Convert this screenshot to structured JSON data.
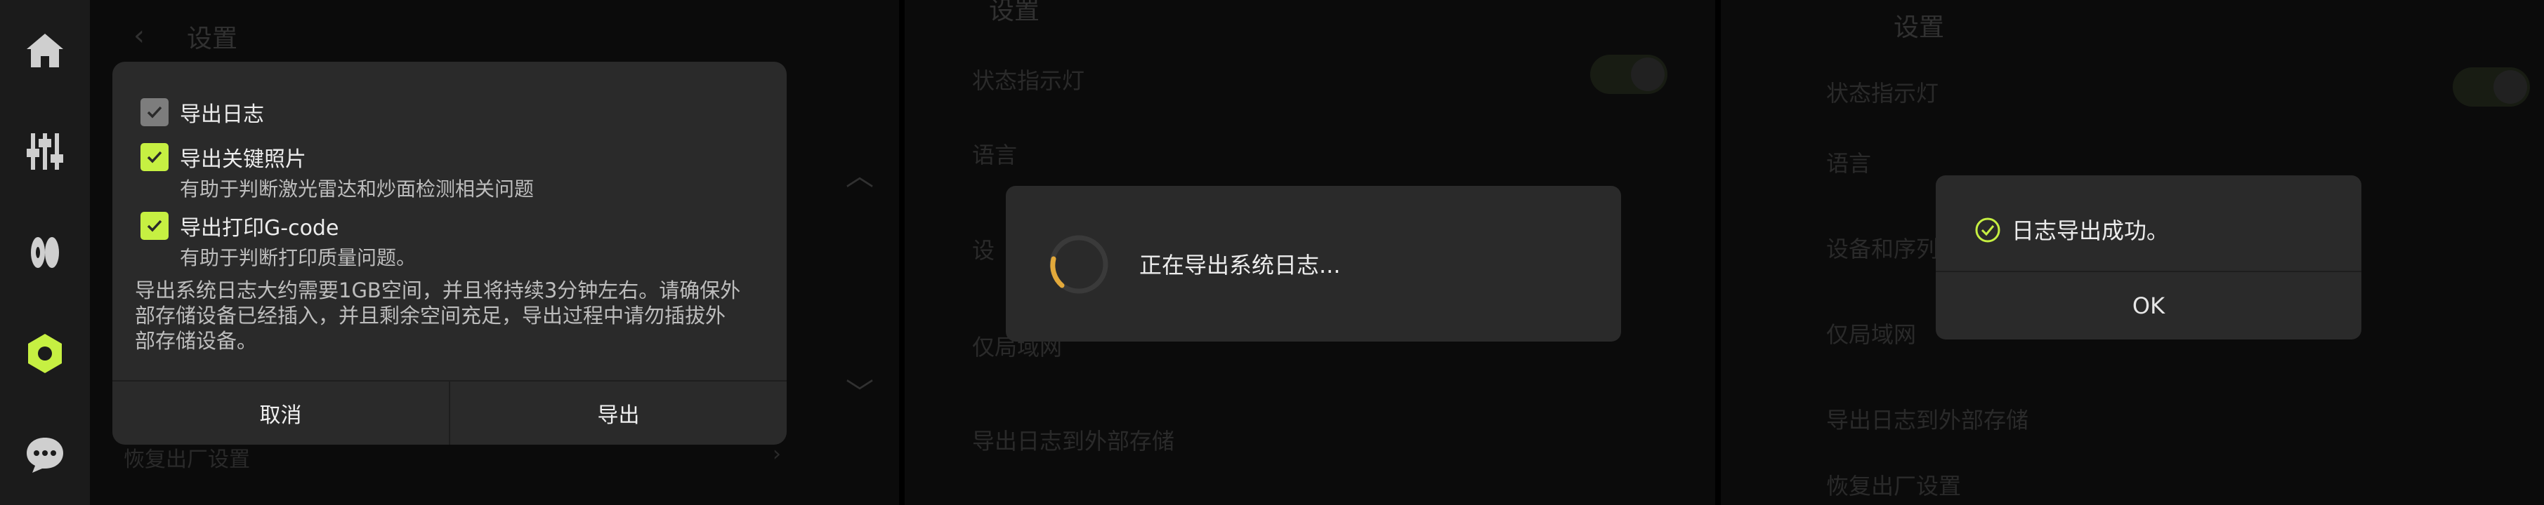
{
  "panel1": {
    "header": {
      "title": "设置"
    },
    "background_rows": {
      "factory_reset": "恢复出厂设置"
    },
    "dialog": {
      "options": [
        {
          "label": "导出日志",
          "checked": true,
          "style": "gray",
          "description": ""
        },
        {
          "label": "导出关键照片",
          "checked": true,
          "style": "green",
          "description": "有助于判断激光雷达和炒面检测相关问题"
        },
        {
          "label": "导出打印G-code",
          "checked": true,
          "style": "green",
          "description": "有助于判断打印质量问题。"
        }
      ],
      "note_lines": [
        "导出系统日志大约需要1GB空间，并且将持续3分钟左右。请确保外",
        "部存储设备已经插入，并且剩余空间充足，导出过程中请勿插拔外",
        "部存储设备。"
      ],
      "cancel_label": "取消",
      "export_label": "导出"
    },
    "sidebar_icons": [
      "home-icon",
      "sliders-icon",
      "filament-icon",
      "settings-hex-icon",
      "chat-icon"
    ],
    "accent_color": "#c6f042"
  },
  "panel2": {
    "header": {
      "title": "设置"
    },
    "background_rows": {
      "status_light": "状态指示灯",
      "language": "语言",
      "device": "设",
      "camera": "仅局域网",
      "export_logs": "导出日志到外部存储"
    },
    "loading_text": "正在导出系统日志..."
  },
  "panel3": {
    "header": {
      "title": "设置"
    },
    "background_rows": {
      "status_light": "状态指示灯",
      "language": "语言",
      "device": "设备和序列号",
      "lan_only": "仅局域网",
      "export_logs": "导出日志到外部存储",
      "factory_reset": "恢复出厂设置"
    },
    "success_text": "日志导出成功。",
    "ok_label": "OK"
  }
}
